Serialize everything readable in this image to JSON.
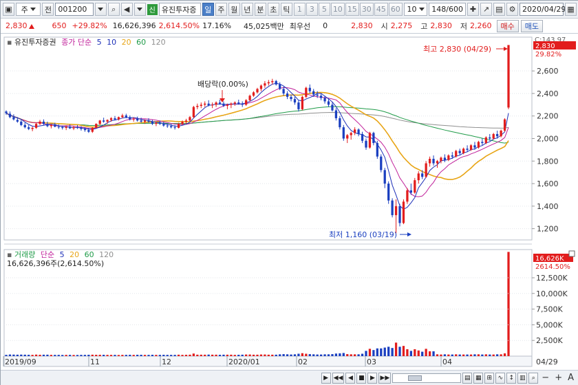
{
  "toolbar": {
    "market_type": "주",
    "prev_label": "전",
    "stock_code": "001200",
    "badge": "신",
    "stock_name": "유진투자증",
    "period_day": "일",
    "period_week": "주",
    "period_month": "월",
    "period_year": "년",
    "period_minute": "분",
    "period_second": "초",
    "period_tick": "틱",
    "intervals": [
      "1",
      "3",
      "5",
      "10",
      "15",
      "30",
      "45",
      "60"
    ],
    "interval_selected": "10",
    "count": "148/600",
    "date": "2020/04/29"
  },
  "quote": {
    "price": "2,830",
    "change": "650",
    "change_pct": "+29.82%",
    "volume": "16,626,396",
    "volume_pct": "2,614.50%",
    "turnover": "17.16%",
    "amount": "45,025백만",
    "priority_label": "최우선",
    "priority_value": "0",
    "ask_price": "2,830",
    "open_label": "시",
    "open_value": "2,275",
    "high_label": "고",
    "high_value": "2,830",
    "low_label": "저",
    "low_value": "2,260",
    "buy_label": "매수",
    "sell_label": "매도"
  },
  "colors": {
    "up": "#e21d1d",
    "down": "#1a3fc0",
    "ma5": "#1c2fb8",
    "ma10": "#c0209a",
    "ma20": "#e8a516",
    "ma60": "#1f9b48",
    "ma120": "#8f8f8f"
  },
  "chart_data": [
    {
      "type": "candlestick",
      "legend": {
        "name": "유진투자증권",
        "price_type": "종가 단순",
        "ma_periods": [
          "5",
          "10",
          "20",
          "60",
          "120"
        ]
      },
      "y_axis_ticks": [
        "2,600",
        "2,400",
        "2,200",
        "2,000",
        "1,800",
        "1,600",
        "1,400",
        "1,200"
      ],
      "y_tick_values": [
        2600,
        2400,
        2200,
        2000,
        1800,
        1600,
        1400,
        1200
      ],
      "ylim": [
        1100,
        2900
      ],
      "top_axis_label": "C:143.97",
      "last_price_label": "2,830",
      "last_pct_label": "29.82%",
      "annotations": {
        "high": "최고 2,830 (04/29)",
        "low": "최저 1,160 (03/19)",
        "dividend": "배당락(0.00%)"
      },
      "ohlc": [
        [
          2240,
          2250,
          2210,
          2225
        ],
        [
          2220,
          2240,
          2180,
          2190
        ],
        [
          2190,
          2215,
          2160,
          2170
        ],
        [
          2165,
          2190,
          2140,
          2150
        ],
        [
          2150,
          2165,
          2110,
          2120
        ],
        [
          2120,
          2140,
          2090,
          2100
        ],
        [
          2100,
          2120,
          2075,
          2085
        ],
        [
          2085,
          2105,
          2065,
          2095
        ],
        [
          2095,
          2140,
          2085,
          2130
        ],
        [
          2130,
          2165,
          2120,
          2150
        ],
        [
          2150,
          2170,
          2120,
          2130
        ],
        [
          2130,
          2150,
          2100,
          2110
        ],
        [
          2110,
          2130,
          2090,
          2120
        ],
        [
          2120,
          2140,
          2100,
          2105
        ],
        [
          2105,
          2125,
          2085,
          2100
        ],
        [
          2100,
          2115,
          2080,
          2095
        ],
        [
          2095,
          2115,
          2075,
          2105
        ],
        [
          2105,
          2125,
          2085,
          2090
        ],
        [
          2090,
          2110,
          2075,
          2100
        ],
        [
          2100,
          2120,
          2085,
          2095
        ],
        [
          2095,
          2110,
          2070,
          2085
        ],
        [
          2085,
          2100,
          2060,
          2075
        ],
        [
          2075,
          2095,
          2050,
          2060
        ],
        [
          2060,
          2100,
          2050,
          2095
        ],
        [
          2095,
          2135,
          2090,
          2130
        ],
        [
          2130,
          2165,
          2120,
          2160
        ],
        [
          2160,
          2185,
          2140,
          2150
        ],
        [
          2150,
          2170,
          2130,
          2165
        ],
        [
          2165,
          2190,
          2150,
          2180
        ],
        [
          2180,
          2200,
          2160,
          2170
        ],
        [
          2170,
          2195,
          2160,
          2190
        ],
        [
          2190,
          2220,
          2180,
          2205
        ],
        [
          2205,
          2220,
          2180,
          2190
        ],
        [
          2190,
          2205,
          2160,
          2170
        ],
        [
          2170,
          2190,
          2150,
          2175
        ],
        [
          2175,
          2195,
          2150,
          2160
        ],
        [
          2160,
          2185,
          2140,
          2150
        ],
        [
          2150,
          2170,
          2130,
          2160
        ],
        [
          2160,
          2180,
          2140,
          2150
        ],
        [
          2150,
          2165,
          2120,
          2130
        ],
        [
          2130,
          2150,
          2110,
          2140
        ],
        [
          2140,
          2160,
          2120,
          2130
        ],
        [
          2130,
          2150,
          2105,
          2115
        ],
        [
          2115,
          2135,
          2095,
          2110
        ],
        [
          2110,
          2130,
          2090,
          2100
        ],
        [
          2100,
          2120,
          2080,
          2095
        ],
        [
          2095,
          2140,
          2090,
          2130
        ],
        [
          2130,
          2160,
          2120,
          2150
        ],
        [
          2150,
          2175,
          2130,
          2160
        ],
        [
          2160,
          2200,
          2150,
          2190
        ],
        [
          2190,
          2290,
          2180,
          2280
        ],
        [
          2280,
          2310,
          2260,
          2290
        ],
        [
          2290,
          2320,
          2270,
          2300
        ],
        [
          2300,
          2330,
          2280,
          2310
        ],
        [
          2310,
          2340,
          2285,
          2295
        ],
        [
          2295,
          2320,
          2270,
          2300
        ],
        [
          2300,
          2330,
          2280,
          2320
        ],
        [
          2320,
          2345,
          2300,
          2310
        ],
        [
          2310,
          2330,
          2280,
          2290
        ],
        [
          2290,
          2310,
          2260,
          2300
        ],
        [
          2300,
          2320,
          2270,
          2310
        ],
        [
          2310,
          2330,
          2290,
          2320
        ],
        [
          2320,
          2345,
          2300,
          2310
        ],
        [
          2310,
          2330,
          2280,
          2300
        ],
        [
          2300,
          2350,
          2290,
          2340
        ],
        [
          2340,
          2390,
          2330,
          2380
        ],
        [
          2380,
          2420,
          2370,
          2410
        ],
        [
          2410,
          2450,
          2400,
          2440
        ],
        [
          2440,
          2480,
          2420,
          2470
        ],
        [
          2470,
          2510,
          2450,
          2490
        ],
        [
          2490,
          2520,
          2470,
          2500
        ],
        [
          2500,
          2530,
          2480,
          2510
        ],
        [
          2510,
          2520,
          2470,
          2480
        ],
        [
          2480,
          2500,
          2430,
          2440
        ],
        [
          2440,
          2460,
          2380,
          2400
        ],
        [
          2400,
          2420,
          2350,
          2370
        ],
        [
          2370,
          2390,
          2330,
          2350
        ],
        [
          2350,
          2370,
          2300,
          2320
        ],
        [
          2320,
          2340,
          2240,
          2260
        ],
        [
          2260,
          2380,
          2250,
          2370
        ],
        [
          2370,
          2460,
          2360,
          2450
        ],
        [
          2450,
          2480,
          2400,
          2420
        ],
        [
          2420,
          2440,
          2370,
          2390
        ],
        [
          2390,
          2420,
          2360,
          2380
        ],
        [
          2380,
          2400,
          2340,
          2360
        ],
        [
          2360,
          2380,
          2310,
          2330
        ],
        [
          2330,
          2350,
          2280,
          2300
        ],
        [
          2300,
          2320,
          2240,
          2250
        ],
        [
          2250,
          2270,
          2160,
          2180
        ],
        [
          2180,
          2200,
          2080,
          2100
        ],
        [
          2100,
          2120,
          1980,
          2000
        ],
        [
          2000,
          2040,
          1960,
          2030
        ],
        [
          2030,
          2060,
          1990,
          2050
        ],
        [
          2050,
          2100,
          2030,
          2080
        ],
        [
          2080,
          2090,
          2020,
          2040
        ],
        [
          2040,
          2060,
          1960,
          1980
        ],
        [
          1980,
          2000,
          1900,
          1920
        ],
        [
          1920,
          2060,
          1910,
          2050
        ],
        [
          2050,
          2060,
          1940,
          1960
        ],
        [
          1960,
          1980,
          1820,
          1840
        ],
        [
          1840,
          1860,
          1700,
          1720
        ],
        [
          1720,
          1740,
          1560,
          1600
        ],
        [
          1600,
          1620,
          1420,
          1450
        ],
        [
          1450,
          1470,
          1300,
          1320
        ],
        [
          1320,
          1460,
          1160,
          1400
        ],
        [
          1400,
          1420,
          1220,
          1250
        ],
        [
          1250,
          1460,
          1240,
          1440
        ],
        [
          1440,
          1560,
          1420,
          1540
        ],
        [
          1540,
          1600,
          1500,
          1520
        ],
        [
          1520,
          1650,
          1510,
          1630
        ],
        [
          1630,
          1710,
          1600,
          1690
        ],
        [
          1690,
          1720,
          1640,
          1660
        ],
        [
          1660,
          1800,
          1650,
          1780
        ],
        [
          1780,
          1840,
          1750,
          1820
        ],
        [
          1820,
          1850,
          1760,
          1780
        ],
        [
          1780,
          1810,
          1740,
          1800
        ],
        [
          1800,
          1840,
          1780,
          1830
        ],
        [
          1830,
          1860,
          1790,
          1810
        ],
        [
          1810,
          1860,
          1800,
          1850
        ],
        [
          1850,
          1880,
          1820,
          1840
        ],
        [
          1840,
          1900,
          1830,
          1890
        ],
        [
          1890,
          1910,
          1850,
          1870
        ],
        [
          1870,
          1920,
          1860,
          1910
        ],
        [
          1910,
          1940,
          1880,
          1900
        ],
        [
          1900,
          1950,
          1890,
          1940
        ],
        [
          1940,
          1970,
          1900,
          1920
        ],
        [
          1920,
          1980,
          1910,
          1970
        ],
        [
          1970,
          2000,
          1940,
          1960
        ],
        [
          1960,
          2020,
          1950,
          2010
        ],
        [
          2010,
          2040,
          1980,
          2000
        ],
        [
          2000,
          2050,
          1990,
          2040
        ],
        [
          2040,
          2070,
          2000,
          2020
        ],
        [
          2020,
          2080,
          2010,
          2070
        ],
        [
          2070,
          2180,
          2060,
          2170
        ],
        [
          2275,
          2830,
          2260,
          2830
        ]
      ]
    },
    {
      "type": "bar",
      "legend": {
        "name": "거래량",
        "price_type": "단순",
        "ma_periods": [
          "5",
          "20",
          "60",
          "120"
        ]
      },
      "summary": "16,626,396주(2,614.50%)",
      "y_axis_ticks": [
        "12,500K",
        "10,000K",
        "7,500K",
        "5,000K",
        "2,500K"
      ],
      "y_tick_values": [
        12500,
        10000,
        7500,
        5000,
        2500
      ],
      "ylim": [
        0,
        17000
      ],
      "last_volume_label": "16,626K",
      "last_pct_label": "2614.50%",
      "x_axis_labels": [
        "2019/09",
        "11",
        "12",
        "2020/01",
        "02",
        "03",
        "04",
        "04/29"
      ]
    }
  ]
}
